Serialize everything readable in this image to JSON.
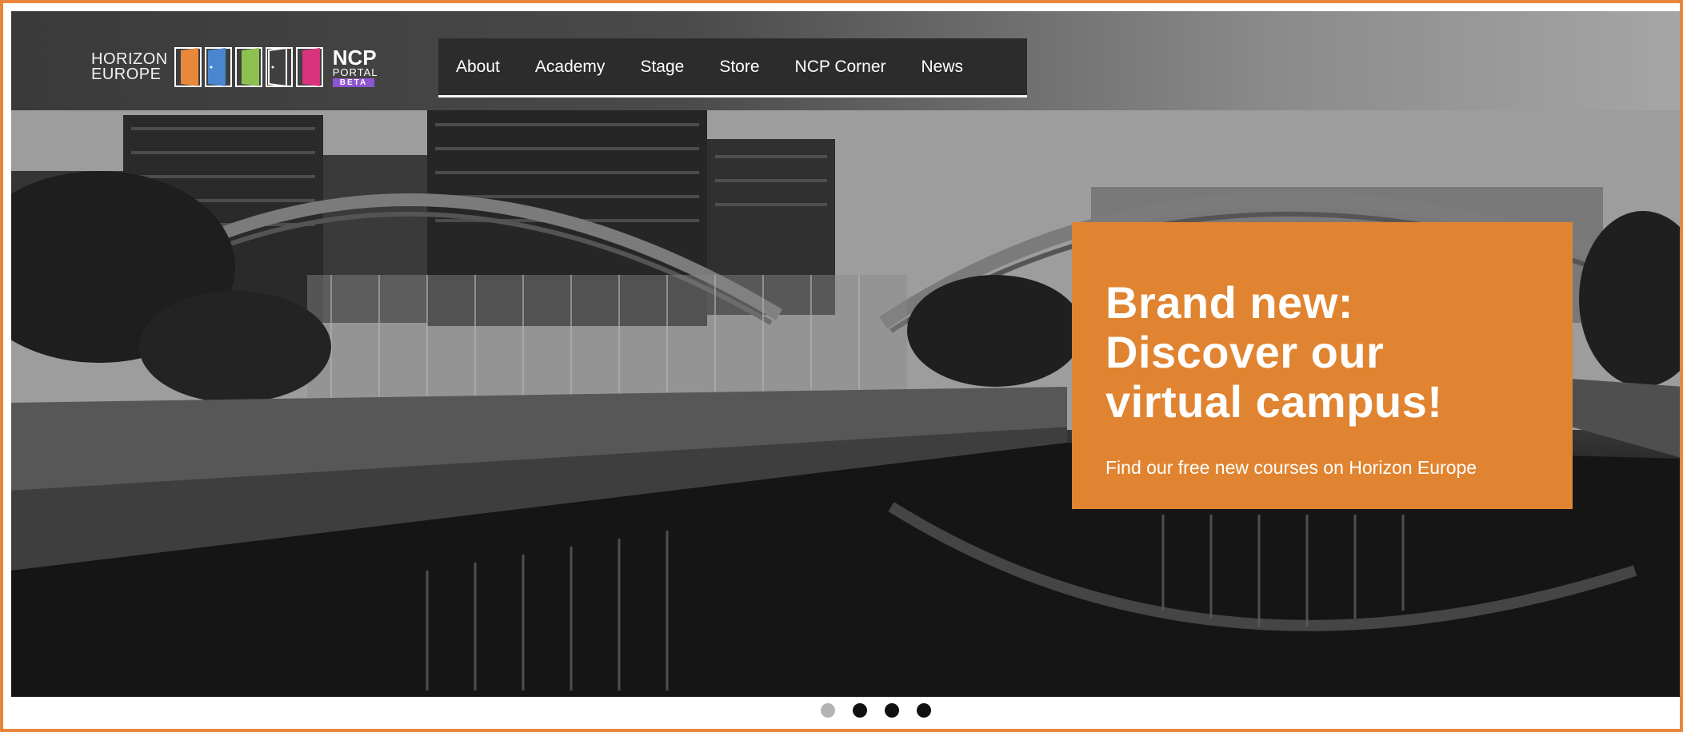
{
  "brand": {
    "horizon_line1": "HORIZON",
    "horizon_line2": "EUROPE",
    "ncp_title": "NCP",
    "ncp_sub": "PORTAL",
    "ncp_beta": "BETA",
    "door_colors": [
      "#e8883b",
      "#4a86cf",
      "#8cc152",
      "#ffffff",
      "#d8337d"
    ]
  },
  "nav": {
    "items": [
      "About",
      "Academy",
      "Stage",
      "Store",
      "NCP Corner",
      "News"
    ]
  },
  "promo": {
    "title_line1": "Brand new:",
    "title_line2": "Discover our",
    "title_line3": "virtual campus!",
    "subtitle": "Find our free new courses on Horizon Europe",
    "background": "#e08431"
  },
  "carousel": {
    "active_index": 0,
    "count": 4
  },
  "colors": {
    "frame_border": "#e8853a",
    "nav_background": "#2c2c2c"
  }
}
